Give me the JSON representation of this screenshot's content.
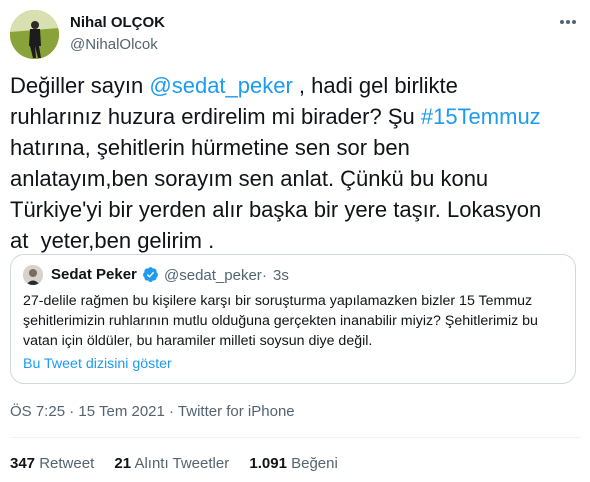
{
  "author": {
    "name": "Nihal OLÇOK",
    "handle": "@NihalOlcok"
  },
  "tweet": {
    "text_before": "Değiller sayın ",
    "mention": "@sedat_peker",
    "text_middle": " , hadi gel birlikte\nruhlarınız huzura erdirelim mi birader? Şu ",
    "hashtag": "#15Temmuz",
    "text_after": "\nhatırına, şehitlerin hürmetine sen sor ben\nanlatayım,ben sorayım sen anlat. Çünkü bu konu\nTürkiye'yi bir yerden alır başka bir yere taşır. Lokasyon\nat  yeter,ben gelirim ."
  },
  "quoted": {
    "name": "Sedat Peker",
    "handle": "@sedat_peker",
    "dot": "·",
    "time": "3s",
    "text": "27-delile rağmen bu kişilere karşı bir soruşturma yapılamazken bizler 15 Temmuz şehitlerimizin ruhlarının mutlu olduğuna gerçekten inanabilir miyiz? Şehitlerimiz bu vatan için öldüler, bu haramiler milleti soysun diye değil.",
    "show_thread": "Bu Tweet dizisini göster"
  },
  "meta": {
    "time": "ÖS 7:25",
    "sep1": " · ",
    "date": "15 Tem 2021",
    "sep2": " · ",
    "source": "Twitter for iPhone"
  },
  "stats": [
    {
      "count": "347",
      "label": "Retweet"
    },
    {
      "count": "21",
      "label": "Alıntı Tweetler"
    },
    {
      "count": "1.091",
      "label": "Beğeni"
    }
  ],
  "icons": {
    "more": "more-horizontal-icon",
    "verified": "verified-badge-icon"
  },
  "colors": {
    "link": "#1d9bf0",
    "secondary": "#536471",
    "border": "#cfd9de"
  }
}
